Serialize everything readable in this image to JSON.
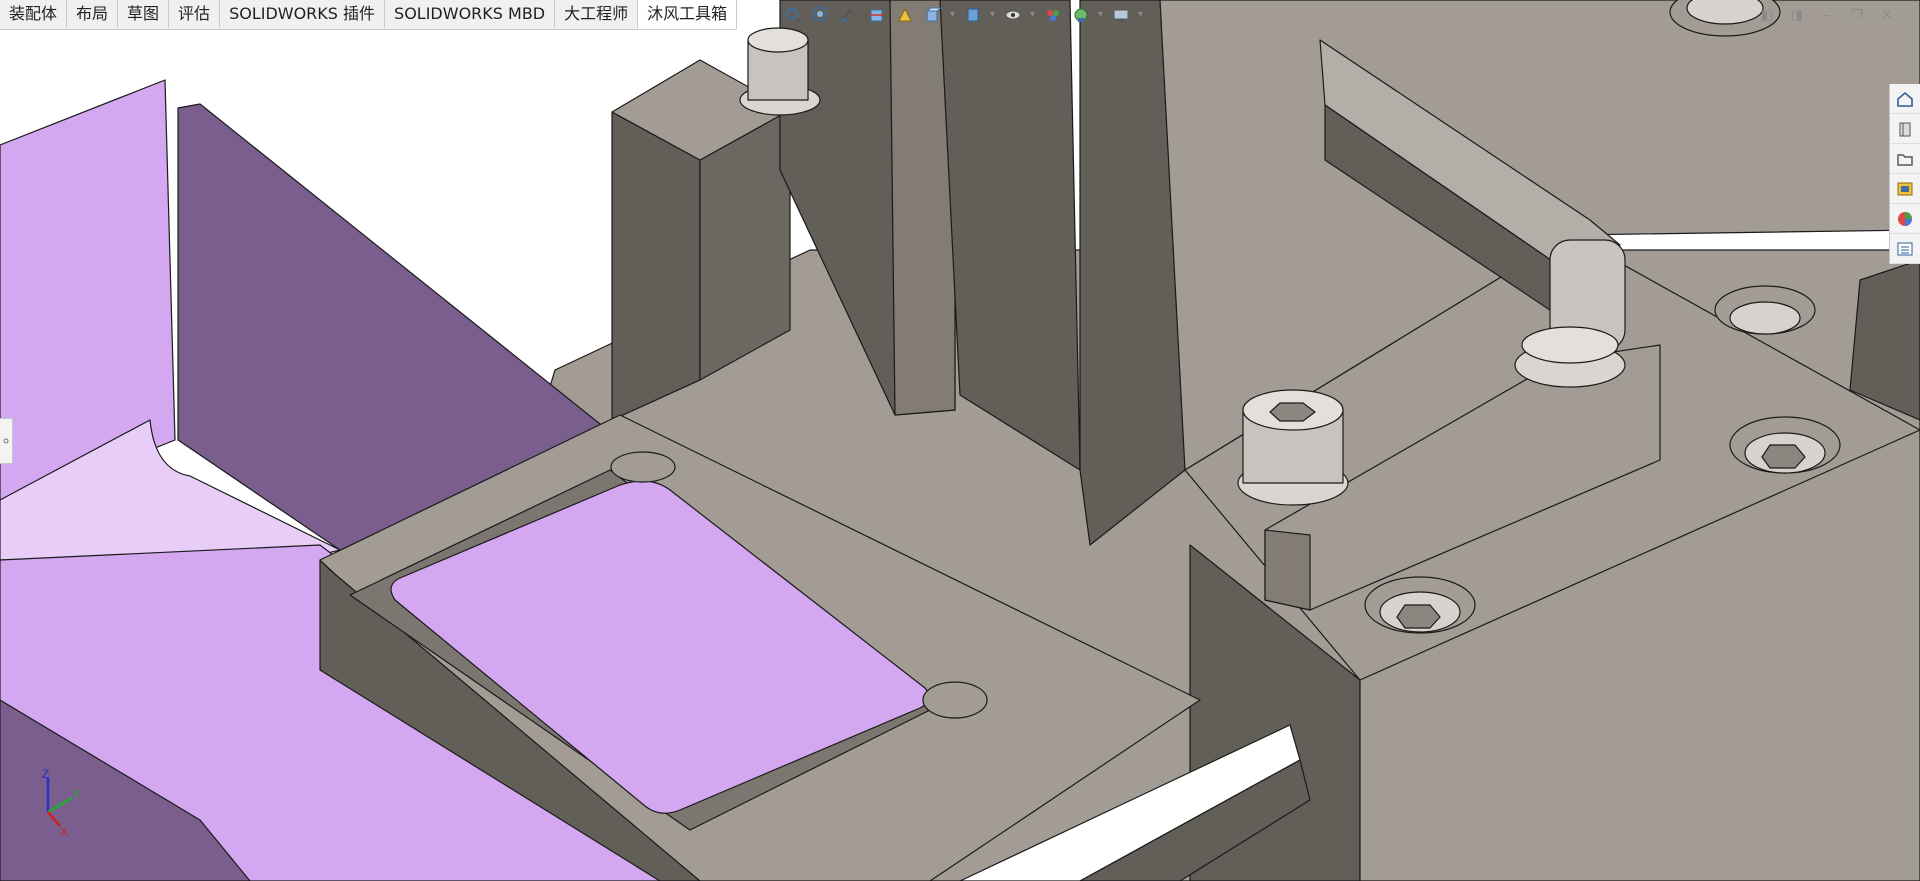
{
  "command_manager": {
    "tabs": [
      {
        "label": "装配体",
        "active": false
      },
      {
        "label": "布局",
        "active": false
      },
      {
        "label": "草图",
        "active": false
      },
      {
        "label": "评估",
        "active": false
      },
      {
        "label": "SOLIDWORKS 插件",
        "active": false
      },
      {
        "label": "SOLIDWORKS MBD",
        "active": false
      },
      {
        "label": "大工程师",
        "active": false
      },
      {
        "label": "沐风工具箱",
        "active": true
      }
    ]
  },
  "heads_up_toolbar": {
    "buttons": [
      "zoom-to-fit-icon",
      "zoom-to-area-icon",
      "previous-view-icon",
      "section-view-icon",
      "dynamic-annotation-icon",
      "view-orientation-icon",
      "display-style-icon",
      "hide-show-items-icon",
      "edit-appearance-icon",
      "apply-scene-icon",
      "view-settings-icon"
    ]
  },
  "window_controls": {
    "buttons": [
      "tile-left-icon",
      "tile-right-icon",
      "minimize-icon",
      "restore-icon",
      "close-icon"
    ]
  },
  "task_pane": {
    "buttons": [
      "solidworks-resources-icon",
      "design-library-icon",
      "file-explorer-icon",
      "view-palette-icon",
      "appearances-scenes-icon",
      "custom-properties-icon"
    ]
  },
  "triad": {
    "x_label": "X",
    "y_label": "Y",
    "z_label": "Z"
  },
  "colors": {
    "part_purple": "#d3a8f0",
    "part_purple_dark": "#7a5f8e",
    "metal_light": "#a39c95",
    "metal_dark": "#625e58",
    "background": "#ffffff"
  }
}
